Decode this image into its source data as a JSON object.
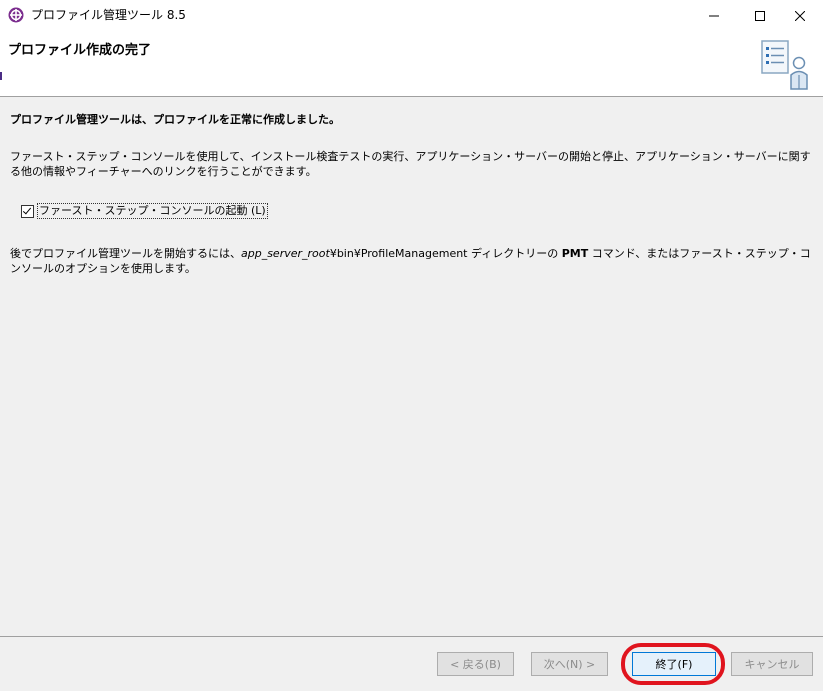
{
  "window": {
    "title": "プロファイル管理ツール 8.5",
    "minimize_glyph": "—",
    "maximize_glyph": "□",
    "close_glyph": "✕"
  },
  "header": {
    "title": "プロファイル作成の完了",
    "graphic_icon": "checklist-person-icon"
  },
  "content": {
    "success_message": "プロファイル管理ツールは、プロファイルを正常に作成しました。",
    "description": "ファースト・ステップ・コンソールを使用して、インストール検査テストの実行、アプリケーション・サーバーの開始と停止、アプリケーション・サーバーに関する他の情報やフィーチャーへのリンクを行うことができます。",
    "checkbox": {
      "label": "ファースト・ステップ・コンソールの起動 (L)",
      "checked": true
    },
    "note": {
      "prefix": "後でプロファイル管理ツールを開始するには、",
      "path_italic": "app_server_root",
      "path_rest": "¥bin¥ProfileManagement ディレクトリーの ",
      "command_bold": "PMT",
      "suffix": " コマンド、またはファースト・ステップ・コンソールのオプションを使用します。"
    }
  },
  "buttons": {
    "back": "< 戻る(B)",
    "next": "次へ(N) >",
    "finish": "終了(F)",
    "cancel": "キャンセル"
  },
  "colors": {
    "highlight": "#e0141e",
    "finish_border": "#0078d7",
    "app_icon": "#7b2d8e"
  }
}
